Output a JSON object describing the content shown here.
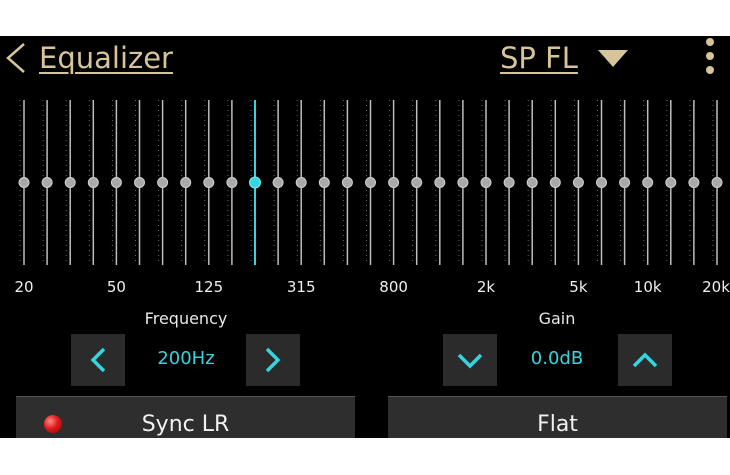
{
  "header": {
    "back_icon": "chevron-left-icon",
    "title": "Equalizer",
    "speaker": "SP FL",
    "caret_icon": "triangle-down-icon",
    "menu_icon": "more-vertical-icon"
  },
  "colors": {
    "background": "#000000",
    "header_text": "#d6c49a",
    "accent": "#35d4de",
    "button_bg": "#2b2b2b",
    "led": "#e01b1b"
  },
  "equalizer": {
    "band_count": 31,
    "selected_band_index": 10,
    "band_gains_db": [
      0,
      0,
      0,
      0,
      0,
      0,
      0,
      0,
      0,
      0,
      0,
      0,
      0,
      0,
      0,
      0,
      0,
      0,
      0,
      0,
      0,
      0,
      0,
      0,
      0,
      0,
      0,
      0,
      0,
      0,
      0
    ],
    "frequency_labels": [
      {
        "band": 0,
        "text": "20"
      },
      {
        "band": 4,
        "text": "50"
      },
      {
        "band": 8,
        "text": "125"
      },
      {
        "band": 12,
        "text": "315"
      },
      {
        "band": 16,
        "text": "800"
      },
      {
        "band": 20,
        "text": "2k"
      },
      {
        "band": 24,
        "text": "5k"
      },
      {
        "band": 27,
        "text": "10k"
      },
      {
        "band": 30,
        "text": "20k"
      }
    ]
  },
  "frequency": {
    "label": "Frequency",
    "value": "200Hz",
    "prev_icon": "chevron-left-icon",
    "next_icon": "chevron-right-icon"
  },
  "gain": {
    "label": "Gain",
    "value": "0.0dB",
    "down_icon": "chevron-down-icon",
    "up_icon": "chevron-up-icon"
  },
  "buttons": {
    "sync_label": "Sync LR",
    "sync_indicator": "red-led-icon",
    "flat_label": "Flat"
  }
}
